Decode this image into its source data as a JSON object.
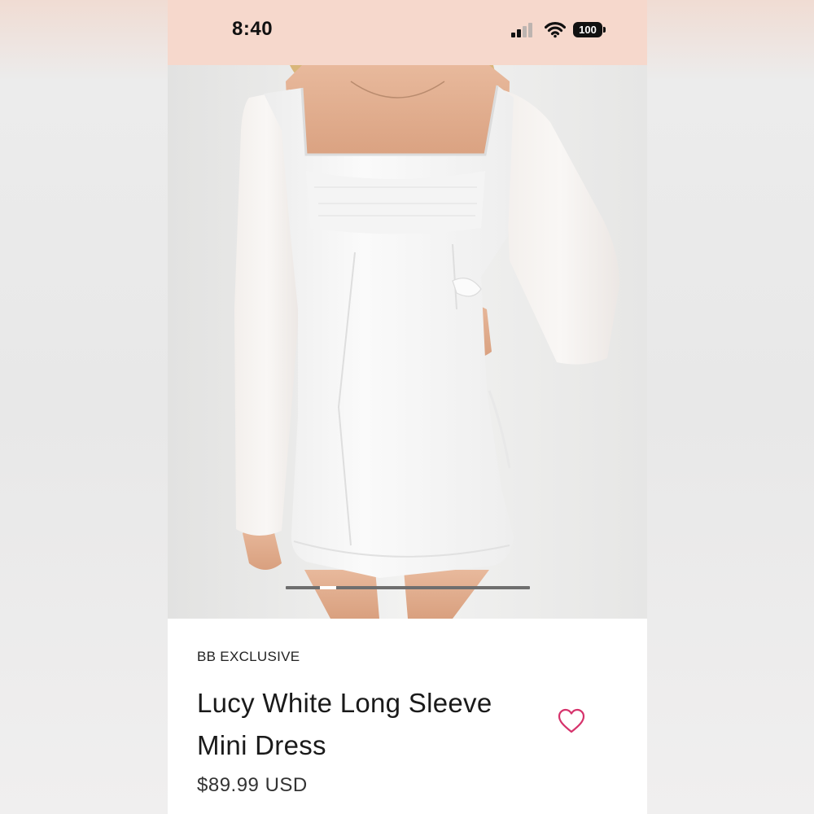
{
  "status_bar": {
    "time": "8:40",
    "battery": "100",
    "icons": [
      "cellular-signal-icon",
      "wifi-icon",
      "battery-icon"
    ]
  },
  "product": {
    "image_alt": "woman wearing white long sleeve mini dress",
    "carousel_active_index": 1,
    "carousel_count": 7,
    "brand": "BB EXCLUSIVE",
    "title": "Lucy White Long Sleeve Mini Dress",
    "price": "$89.99 USD",
    "favorite_icon": "heart-outline-icon"
  },
  "colors": {
    "status_bar_bg": "#f6d8cc",
    "heart": "#d6336c",
    "text": "#1a1a1a"
  }
}
